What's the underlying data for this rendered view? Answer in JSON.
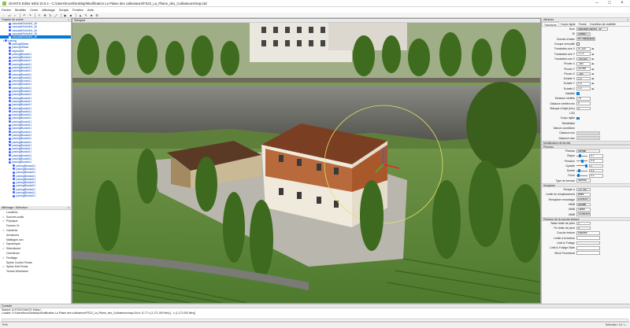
{
  "window": {
    "title": "GIANTS Editor 64bit 10.0.4 - C:/Users/trucs/Desktop/Modification La Plaine des cultivateurs/FS22_La_Plaine_des_Cultivateurs/map.i3d"
  },
  "menu": [
    "Fichier",
    "Modifier",
    "Créer",
    "Affichage",
    "Scripts",
    "Fenêtre",
    "Aide"
  ],
  "scenegraph": {
    "title": "Graphe de scène",
    "items": [
      {
        "label": "cascadeGolioth1_4ll",
        "indent": 1
      },
      {
        "label": "cascadeGolioth1_4ll",
        "indent": 1
      },
      {
        "label": "cascadeGolioth1_4ll",
        "indent": 1
      },
      {
        "label": "cascadeGolioth1_4ll",
        "indent": 1
      },
      {
        "label": "cascadeGolioth1_4ll",
        "indent": 1,
        "selected": true
      },
      {
        "label": "paving",
        "indent": 0
      },
      {
        "label": "pavingDBase",
        "indent": 1
      },
      {
        "label": "pavingUBase",
        "indent": 1
      },
      {
        "label": "asphalt01",
        "indent": 1
      },
      {
        "label": "pavingBlocks01",
        "indent": 1
      },
      {
        "label": "pavingBlocks01",
        "indent": 1
      },
      {
        "label": "pavingBlocks01",
        "indent": 1
      },
      {
        "label": "pavingBlocks01",
        "indent": 1
      },
      {
        "label": "pavingBlocks01",
        "indent": 1
      },
      {
        "label": "pavingBlocks01",
        "indent": 1
      },
      {
        "label": "pavingBlocks01",
        "indent": 1
      },
      {
        "label": "pavingBlocks01",
        "indent": 1
      },
      {
        "label": "pavingBlocks01",
        "indent": 1
      },
      {
        "label": "pavingBlocks01",
        "indent": 1
      },
      {
        "label": "pavingBlocks01",
        "indent": 1
      },
      {
        "label": "pavingBlocks01",
        "indent": 1
      },
      {
        "label": "pavingBlocks01",
        "indent": 1
      },
      {
        "label": "pavingBlocks01",
        "indent": 1
      },
      {
        "label": "pavingBlocks01",
        "indent": 1
      },
      {
        "label": "pavingBlocks01",
        "indent": 1
      },
      {
        "label": "pavingBlocks01",
        "indent": 1
      },
      {
        "label": "pavingBlocks01",
        "indent": 1
      },
      {
        "label": "pavingBlocks01",
        "indent": 1
      },
      {
        "label": "pavingBlocks01",
        "indent": 1
      },
      {
        "label": "pavingBlocks01",
        "indent": 1
      },
      {
        "label": "pavingBlocks01",
        "indent": 1
      },
      {
        "label": "pavingBlocks01",
        "indent": 1
      },
      {
        "label": "pavingBlocks01",
        "indent": 1
      },
      {
        "label": "pavingBlocks01",
        "indent": 1
      },
      {
        "label": "pavingBlocks01",
        "indent": 1
      },
      {
        "label": "pavingBlocks01",
        "indent": 1
      },
      {
        "label": "pavingBlocks01",
        "indent": 1
      },
      {
        "label": "pavingBlocks01",
        "indent": 1
      },
      {
        "label": "pavingBlocks01",
        "indent": 1
      },
      {
        "label": "pavingBlocks01",
        "indent": 1
      },
      {
        "label": "pavingBlocks01",
        "indent": 1
      },
      {
        "label": "pavingBlocks01",
        "indent": 1
      },
      {
        "label": "pavingBlocks01",
        "indent": 2
      },
      {
        "label": "pavingBlocks01",
        "indent": 2
      },
      {
        "label": "pavingBlocks01",
        "indent": 2
      },
      {
        "label": "pavingBlocks01",
        "indent": 2
      },
      {
        "label": "pavingBlocks01",
        "indent": 2
      },
      {
        "label": "pavingBlocks01",
        "indent": 2
      },
      {
        "label": "pavingBlocks01",
        "indent": 2
      },
      {
        "label": "pavingBlocks01",
        "indent": 2
      },
      {
        "label": "pavingBlocks01",
        "indent": 2
      },
      {
        "label": "pavingBlocks01",
        "indent": 2
      }
    ]
  },
  "attrs_panel": {
    "title": "Affichage / Sélection",
    "items": [
      {
        "label": "Lumières",
        "check": ""
      },
      {
        "label": "Sources audio",
        "check": "✓"
      },
      {
        "label": "Physique",
        "check": "✓"
      },
      {
        "label": "Formes VL",
        "check": ""
      },
      {
        "label": "Caméras",
        "check": "✓"
      },
      {
        "label": "Armatures",
        "check": ""
      },
      {
        "label": "Maillages non",
        "check": ""
      },
      {
        "label": "Dynamique",
        "check": "✓"
      },
      {
        "label": "Sélectionné",
        "check": "✓"
      },
      {
        "label": "Occulteurs",
        "check": ""
      },
      {
        "label": "Feuillage",
        "check": "✓"
      },
      {
        "label": "Spline Control Points",
        "check": ""
      },
      {
        "label": "Spline Edit Points",
        "check": "✓"
      },
      {
        "label": "Terrain Wireframe",
        "check": ""
      }
    ]
  },
  "viewport": {
    "title": "Viewport"
  },
  "attributes": {
    "title": "Attributs",
    "tabs": [
      "Transform",
      "Corps rigide",
      "Forme",
      "Condition de visibilité"
    ],
    "nom_label": "Nom",
    "nom": "cascadeGolioth1_4ll",
    "id_label": "ID",
    "id": "128467",
    "chemin_label": "Chemin d'index",
    "chemin": "0>..>8|3|2|12|4",
    "groupe_label": "Groupe verrouillé",
    "tx_label": "Translation axe X",
    "tx": "97.220",
    "ty_label": "Translation axe Y",
    "ty": "-2.72",
    "tz_label": "Translation axe Z",
    "tz": "-900.857",
    "rx_label": "Pivoter X",
    "rx": "-180",
    "ry_label": "Pivoter Y",
    "ry": "30.096",
    "rz_label": "Pivoter Z",
    "rz": "-180",
    "sx_label": "Echelle X",
    "sx": "1.0",
    "sy_label": "Echelle Y",
    "sy": "1.0",
    "sz_label": "Echelle Z",
    "sz": "1.0",
    "vis_label": "Visibilité",
    "dist_label": "Distance vérifiée",
    "dist": "75",
    "distmin_label": "Distance vérifiée min",
    "distmin": "0",
    "masque_label": "Masque d'objet (hex)",
    "masque": "0",
    "lod_label": "LOD",
    "corps_label": "Corps rigide",
    "rel_label": "Réinitialisé",
    "vcond_label": "Valeurs conditions",
    "dmin_label": "Distance min",
    "dmax_label": "Distance max"
  },
  "filtre": {
    "title": "Modification de terrain",
    "sect": "Pinceau",
    "pinceau_label": "Pinceau",
    "pinceau": "normal",
    "rayon_label": "Rayon",
    "rayon": "0.7",
    "pression_label": "Pression",
    "pression": "0.5",
    "opac_label": "Opacité",
    "opac": "1",
    "durete_label": "Dureté",
    "durete": "0.2",
    "force_label": "Force",
    "force": "0.1",
    "type_label": "Type de formule",
    "type": "Normal",
    "sect2": "Sculpture",
    "remplir_label": "Remplir à",
    "remplir": "127.357",
    "limit_label": "Limite de remplissement",
    "limit": "Base",
    "remplacer_label": "Remplacer remaniage",
    "remplacer": "CTRL R",
    "ajout_label": "MMB",
    "ajout": "Ajouter",
    "lisser_label": "MMB",
    "lisser": "Lisser",
    "aplanir_label": "MMB",
    "aplanir": "Soustraire",
    "sect3": "Peinture de la couche texture",
    "statut_label": "Statut limite de peint",
    "statut": "2",
    "fin_label": "Fin limite de peint",
    "fin": "0",
    "couche_label": "Couche texture",
    "couche": "cultures",
    "limite1_label": "Limite à la texture",
    "limite1": "",
    "limite2_label": "Limit to Foliage",
    "limite2": "",
    "limite3_label": "Limit to Foliage State",
    "limite3": "",
    "block_label": "Block Procedural",
    "block": ""
  },
  "console": {
    "title": "Console",
    "lines": [
      "Started: D:/FS22/GIANTS Editor/...",
      "Loaded: D:/Users/trucs/Desktop/Modification La Plaine des cultivateurs/FS22_La_Plaine_des_Cultivateurs/map.i3d in 11.77 s (1,171,000 files) [.. s (1,171,000 files)]"
    ]
  },
  "status": {
    "left": "Prêt",
    "right": "Sélection: 1/1 <--"
  }
}
